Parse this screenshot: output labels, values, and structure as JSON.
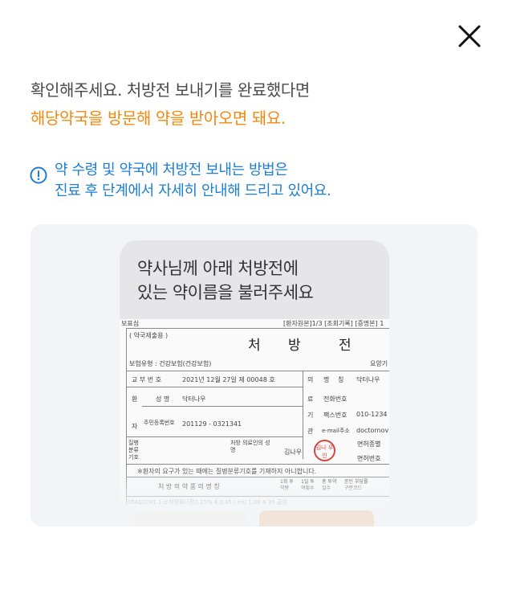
{
  "header": {
    "title_line1": "확인해주세요. 처방전 보내기를 완료했다면",
    "title_line2": "해당약국을 방문해 약을 받아오면 돼요."
  },
  "notice": {
    "line1": "약 수령 및 약국에 처방전 보내는 방법은",
    "line2": "진료 후 단계에서 자세히 안내해 드리고 있어요."
  },
  "phone": {
    "message_line1": "약사님께 아래 처방전에",
    "message_line2": "있는 약이름을 불러주세요"
  },
  "prescription": {
    "top_left": "보표심",
    "top_codes": "[환자원본]1/3 [조회기록] [증명본] 1",
    "submit_label": "( 약국제출용 )",
    "title_a": "처",
    "title_b": "방",
    "title_c": "전",
    "insurance": "보험유형 : 건강보험(건강보험)",
    "side_note": "요양기",
    "issue_no_label": "교 부 번 호",
    "issue_no_value": "2021년 12월 27일 제 00048 호",
    "name_label": "명",
    "name_label2": "칭",
    "clinic_name": "닥터나우",
    "patient_label_a": "환",
    "patient_label_b": "자",
    "patient_name_label": "성 명",
    "patient_name": "닥터나우",
    "phone_label": "전화번호",
    "rrn_label": "주민등록번호",
    "rrn_value": "201129 - 0321341",
    "fax_label": "팩스번호",
    "fax_value": "010-1234",
    "email_label": "e-mail주소",
    "email_value": "doctornov",
    "inst_a": "의",
    "inst_b": "료",
    "inst_c": "기",
    "inst_d": "관",
    "disease_label": "질병 분류 기호",
    "doctor_label": "처방 의료인의 성명",
    "doctor_name": "김나우",
    "stamp_text": "김나 우인",
    "license_label": "면허종별",
    "license_no_label": "면허번호",
    "notice_row": "※환자의 요구가 있는 때에는 질병분류기호를 기재하지 아니합니다.",
    "drug_header": "처 방 의 약 품 의 명 칭",
    "col1": "1회 투약량",
    "col2": "1일 투여횟수",
    "col3": "총 투약일수",
    "col4": "본인 부담률 구분코드",
    "drug_row": "05610291 1 뉴히얌유니정0.15% 4.0.45 / ml/   1.00   4   30   급여"
  }
}
